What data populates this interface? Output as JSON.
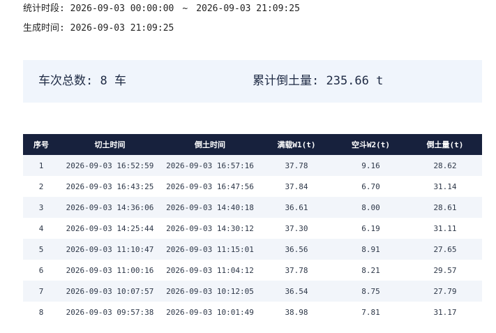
{
  "meta": {
    "period_label": "统计时段:",
    "period_start": "2026-09-03 00:00:00",
    "period_separator": "~",
    "period_end": "2026-09-03 21:09:25",
    "generated_label": "生成时间:",
    "generated_time": "2026-09-03 21:09:25"
  },
  "summary": {
    "count_text": "车次总数: 8 车",
    "volume_text": "累计倒土量: 235.66 t"
  },
  "table": {
    "headers": [
      "序号",
      "切土时间",
      "倒土时间",
      "满载W1(t)",
      "空斗W2(t)",
      "倒土量(t)"
    ],
    "rows": [
      [
        "1",
        "2026-09-03 16:52:59",
        "2026-09-03 16:57:16",
        "37.78",
        "9.16",
        "28.62"
      ],
      [
        "2",
        "2026-09-03 16:43:25",
        "2026-09-03 16:47:56",
        "37.84",
        "6.70",
        "31.14"
      ],
      [
        "3",
        "2026-09-03 14:36:06",
        "2026-09-03 14:40:18",
        "36.61",
        "8.00",
        "28.61"
      ],
      [
        "4",
        "2026-09-03 14:25:44",
        "2026-09-03 14:30:12",
        "37.30",
        "6.19",
        "31.11"
      ],
      [
        "5",
        "2026-09-03 11:10:47",
        "2026-09-03 11:15:01",
        "36.56",
        "8.91",
        "27.65"
      ],
      [
        "6",
        "2026-09-03 11:00:16",
        "2026-09-03 11:04:12",
        "37.78",
        "8.21",
        "29.57"
      ],
      [
        "7",
        "2026-09-03 10:07:57",
        "2026-09-03 10:12:05",
        "36.54",
        "8.75",
        "27.79"
      ],
      [
        "8",
        "2026-09-03 09:57:38",
        "2026-09-03 10:01:49",
        "38.98",
        "7.81",
        "31.17"
      ]
    ]
  }
}
